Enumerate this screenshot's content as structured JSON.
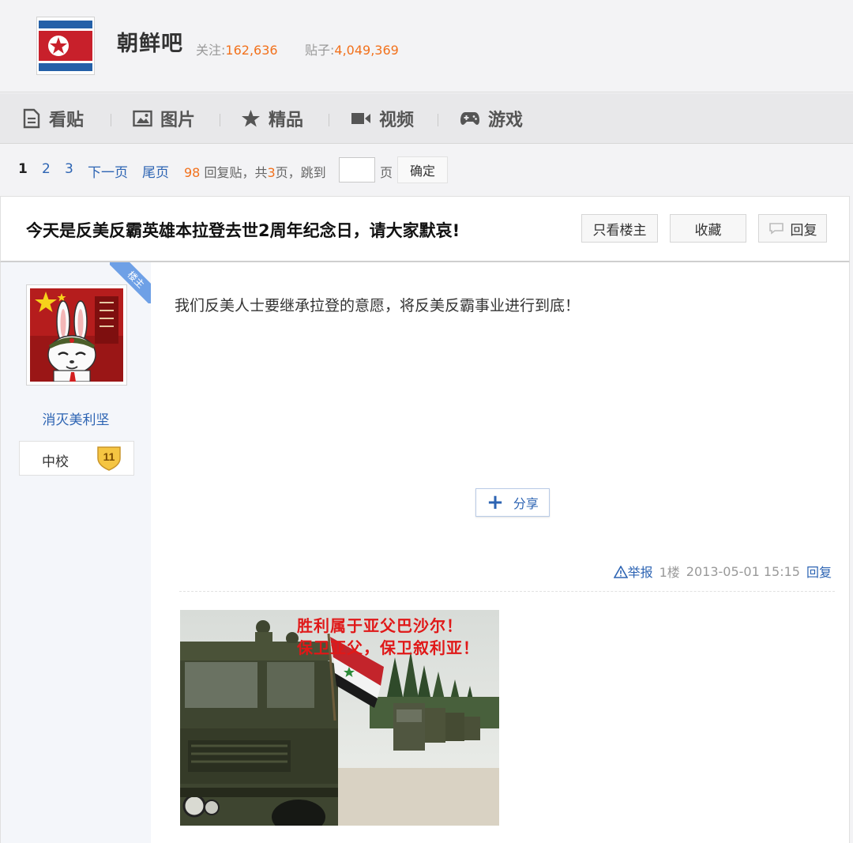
{
  "forum": {
    "name": "朝鲜吧",
    "follow_label": "关注:",
    "follow_count": "162,636",
    "posts_label": "贴子:",
    "posts_count": "4,049,369"
  },
  "tabs": [
    {
      "label": "看贴",
      "icon": "document-icon"
    },
    {
      "label": "图片",
      "icon": "image-icon"
    },
    {
      "label": "精品",
      "icon": "star-icon"
    },
    {
      "label": "视频",
      "icon": "video-camera-icon"
    },
    {
      "label": "游戏",
      "icon": "gamepad-icon"
    }
  ],
  "pager": {
    "pages": [
      "1",
      "2",
      "3"
    ],
    "current": "1",
    "next": "下一页",
    "last": "尾页",
    "reply_count": "98",
    "reply_text": "回复贴，共",
    "total_pages": "3",
    "pages_text": "页，跳到",
    "page_unit": "页",
    "jump_value": "",
    "confirm": "确定"
  },
  "thread": {
    "title": "今天是反美反霸英雄本拉登去世2周年纪念日，请大家默哀!",
    "only_op": "只看楼主",
    "favorite": "收藏",
    "reply": "回复"
  },
  "post": {
    "ribbon": "楼主",
    "username": "消灭美利坚",
    "rank": "中校",
    "level": "11",
    "content": "我们反美人士要继承拉登的意愿，将反美反霸事业进行到底！",
    "share": "分享",
    "report": "举报",
    "floor": "1楼",
    "time": "2013-05-01 15:15",
    "reply": "回复",
    "image_caption_line1": "胜利属于亚父巴沙尔！",
    "image_caption_line2": "保卫亚父，保卫叙利亚！"
  },
  "colors": {
    "link": "#2d64b3",
    "accent_orange": "#f2711c",
    "flag_red": "#c8202b",
    "flag_blue": "#2460a8"
  }
}
